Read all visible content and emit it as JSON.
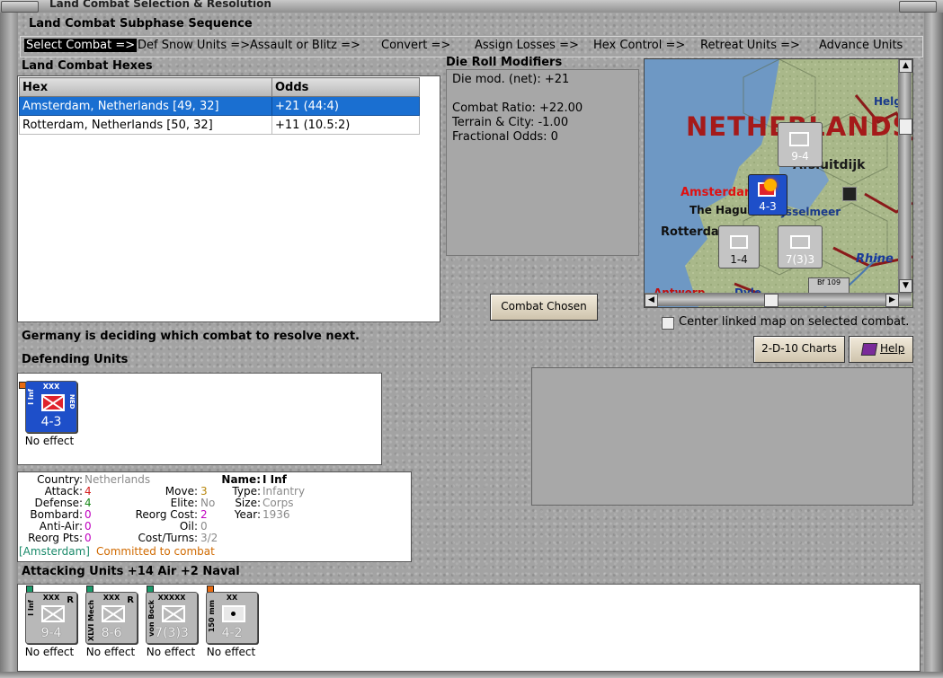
{
  "window": {
    "title": "Land Combat Selection & Resolution"
  },
  "sequence": {
    "title": "Land Combat Subphase Sequence",
    "steps": [
      "Select Combat =>",
      "Def Snow Units =>",
      "Assault or Blitz =>",
      "Convert =>",
      "Assign Losses =>",
      "Hex Control =>",
      "Retreat Units =>",
      "Advance Units"
    ]
  },
  "hexes": {
    "title": "Land Combat Hexes",
    "columns": [
      "Hex",
      "Odds"
    ],
    "rows": [
      {
        "hex": "Amsterdam, Netherlands [49, 32]",
        "odds": "+21 (44:4)",
        "selected": true
      },
      {
        "hex": "Rotterdam, Netherlands [50, 32]",
        "odds": "+11 (10.5:2)",
        "selected": false
      }
    ]
  },
  "drm": {
    "title": "Die Roll Modifiers",
    "lines": [
      "Die mod. (net): +21",
      "",
      "Combat Ratio: +22.00",
      "Terrain & City: -1.00",
      "Fractional Odds: 0"
    ]
  },
  "buttons": {
    "combat_chosen": "Combat Chosen",
    "charts": "2-D-10 Charts",
    "help": "Help"
  },
  "center_map": {
    "label": "Center linked map on selected combat.",
    "checked": false
  },
  "status": "Germany is deciding which combat to resolve next.",
  "defending": {
    "title": "Defending Units",
    "units": [
      {
        "name": "I Inf",
        "size": "XXX",
        "nation": "NED",
        "strength": "4-3",
        "effect": "No effect",
        "color": "#1e4fc9"
      }
    ]
  },
  "unit_info": {
    "country_label": "Country:",
    "country": "Netherlands",
    "attack_label": "Attack:",
    "attack": "4",
    "defense_label": "Defense:",
    "defense": "4",
    "bombard_label": "Bombard:",
    "bombard": "0",
    "antiair_label": "Anti-Air:",
    "antiair": "0",
    "reorg_label": "Reorg Pts:",
    "reorg": "0",
    "move_label": "Move:",
    "move": "3",
    "elite_label": "Elite:",
    "elite": "No",
    "reorg_cost_label": "Reorg Cost:",
    "reorg_cost": "2",
    "oil_label": "Oil:",
    "oil": "0",
    "cost_label": "Cost/Turns:",
    "cost": "3/2",
    "name_label": "Name:",
    "name": "I Inf",
    "type_label": "Type:",
    "type": "Infantry",
    "size_label": "Size:",
    "size": "Corps",
    "year_label": "Year:",
    "year": "1936",
    "location": "[Amsterdam]",
    "committed": "Committed to combat"
  },
  "attacking": {
    "title": "Attacking Units +14 Air +2 Naval",
    "units": [
      {
        "name": "I Inf",
        "size": "XXX",
        "reserve": "R",
        "strength": "9-4",
        "effect": "No effect"
      },
      {
        "name": "XLVI Mech",
        "size": "XXX",
        "reserve": "R",
        "strength": "8-6",
        "effect": "No effect"
      },
      {
        "name": "von Bock",
        "size": "XXXXX",
        "reserve": "",
        "strength": "7(3)3",
        "effect": "No effect"
      },
      {
        "name": "150 mm",
        "size": "XX",
        "reserve": "",
        "strength": "4-2",
        "effect": "No effect"
      }
    ]
  },
  "map": {
    "labels": [
      "NETHERLANDS",
      "Afsluitdijk",
      "Amsterdam",
      "The Hague",
      "Rotterdam",
      "IJsselmeer",
      "Helgo",
      "Rhine",
      "Antwerp",
      "Dyle",
      "Bf 109"
    ],
    "counters": [
      "9-4",
      "4-3",
      "1-4",
      "7(3)3"
    ]
  },
  "colors": {
    "selected_row": "#1a6fd1",
    "attack": "#d42020",
    "defense": "#1a8a1a",
    "bombard": "#c000c0",
    "committed": "#d06a00",
    "location": "#1a8a6a",
    "dutch_unit": "#1e4fc9"
  }
}
